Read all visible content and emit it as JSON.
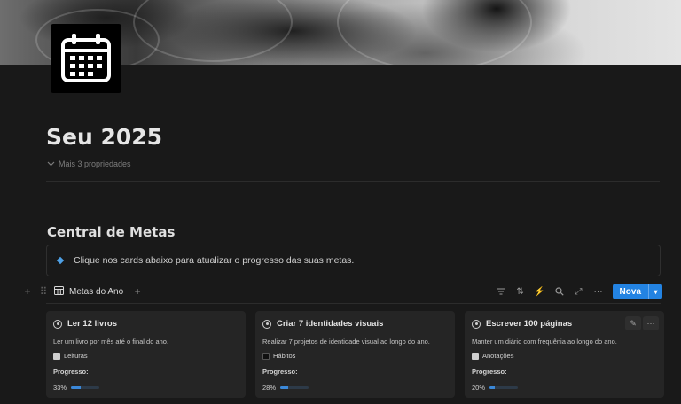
{
  "page": {
    "title": "Seu 2025",
    "properties_toggle": "Mais 3 propriedades"
  },
  "section": {
    "title": "Central de Metas",
    "callout": "Clique nos cards abaixo para atualizar o progresso das suas metas."
  },
  "database": {
    "view_name": "Metas do Ano",
    "new_button": "Nova",
    "toolbar_icons": [
      "filter-icon",
      "sort-icon",
      "lightning-icon",
      "search-icon",
      "expand-icon",
      "more-icon"
    ]
  },
  "cards": [
    {
      "title": "Ler 12 livros",
      "description": "Ler um livro por mês até o final do ano.",
      "relation": "Leituras",
      "progress_label": "Progresso:",
      "progress_text": "33%",
      "progress": 0.33
    },
    {
      "title": "Criar 7 identidades visuais",
      "description": "Realizar 7 projetos de identidade visual ao longo do ano.",
      "relation": "Hábitos",
      "progress_label": "Progresso:",
      "progress_text": "28%",
      "progress": 0.28
    },
    {
      "title": "Escrever 100 páginas",
      "description": "Manter um diário com frequênia ao longo do ano.",
      "relation": "Anotações",
      "progress_label": "Progresso:",
      "progress_text": "20%",
      "progress": 0.2
    }
  ],
  "colors": {
    "background": "#191919",
    "accent": "#2383e2",
    "progress_fill": "#3b88d8"
  }
}
